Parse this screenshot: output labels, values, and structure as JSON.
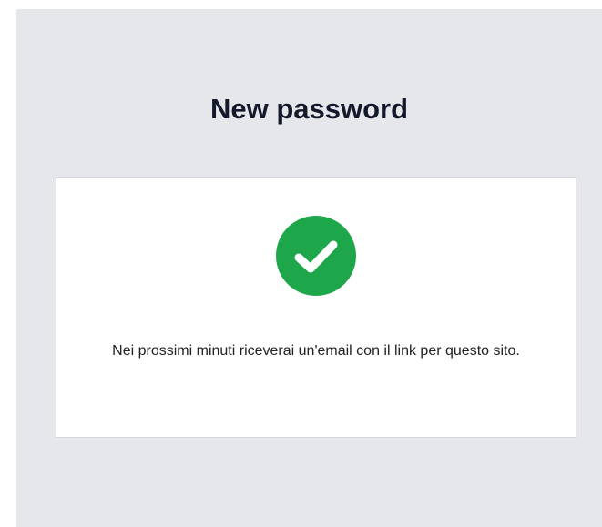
{
  "page": {
    "title": "New password"
  },
  "card": {
    "status_icon": "check-circle-icon",
    "message": "Nei prossimi minuti riceverai un'email con il link per questo sito."
  },
  "colors": {
    "success": "#1ea64b",
    "background": "#e6e7eb",
    "title": "#141a2b"
  }
}
